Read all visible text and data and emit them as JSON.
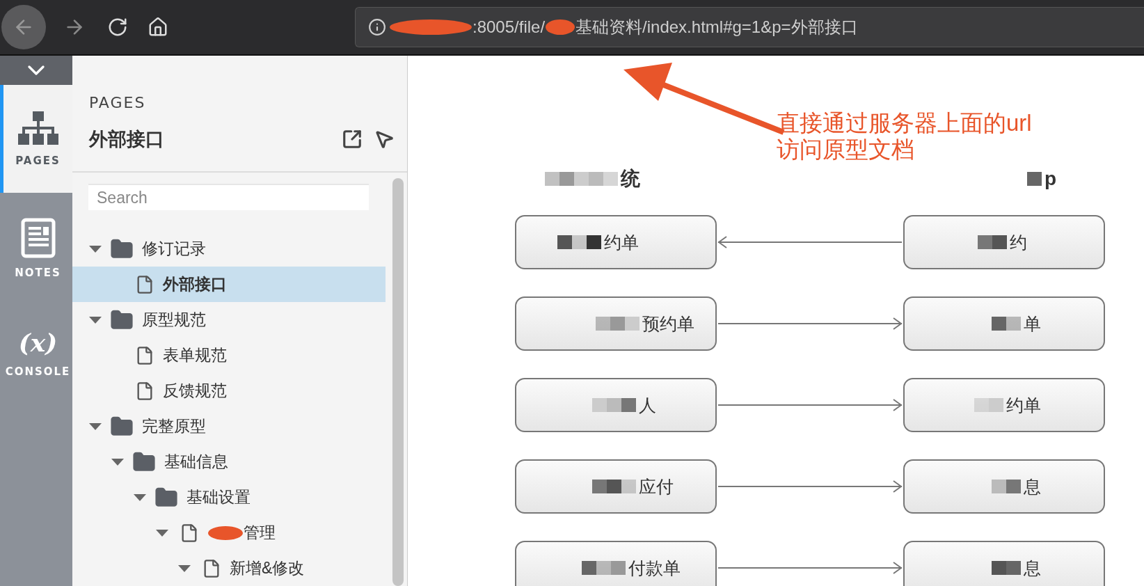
{
  "browser": {
    "address_bar": {
      "segments": [
        {
          "kind": "redacted"
        },
        {
          "kind": "text",
          "text": ":8005/file/"
        },
        {
          "kind": "redacted"
        },
        {
          "kind": "text",
          "text": "基础资料/index.html#g=1&p=外部接口"
        }
      ]
    }
  },
  "rail": {
    "tabs": [
      {
        "label": "PAGES",
        "selected": true
      },
      {
        "label": "NOTES",
        "selected": false
      },
      {
        "label": "CONSOLE",
        "icon_text": "(x)",
        "selected": false
      }
    ]
  },
  "pages_panel": {
    "heading": "PAGES",
    "title": "外部接口",
    "search": {
      "placeholder": "Search"
    },
    "tree": [
      {
        "label": "修订记录",
        "kind": "folder",
        "expanded": true,
        "selected": false,
        "children": [
          {
            "label": "外部接口",
            "kind": "page",
            "selected": true
          }
        ]
      },
      {
        "label": "原型规范",
        "kind": "folder",
        "expanded": true,
        "selected": false,
        "children": [
          {
            "label": "表单规范",
            "kind": "page",
            "selected": false
          },
          {
            "label": "反馈规范",
            "kind": "page",
            "selected": false
          }
        ]
      },
      {
        "label": "完整原型",
        "kind": "folder",
        "expanded": true,
        "selected": false,
        "children": [
          {
            "label": "基础信息",
            "kind": "folder",
            "expanded": true,
            "selected": false,
            "children": [
              {
                "label": "基础设置",
                "kind": "folder",
                "expanded": true,
                "selected": false,
                "children": [
                  {
                    "label": "管理",
                    "redacted": true,
                    "kind": "page",
                    "expanded": true,
                    "selected": false,
                    "children": [
                      {
                        "label": "新增&修改",
                        "kind": "page",
                        "expanded": true,
                        "selected": false
                      }
                    ]
                  }
                ]
              }
            ]
          }
        ]
      }
    ]
  },
  "annotation": {
    "text": "直接通过服务器上面的url\n访问原型文档"
  },
  "diagram": {
    "left_header": {
      "text": "统",
      "mosaic": true
    },
    "right_header": {
      "text": "p",
      "mosaic": true
    },
    "rows": [
      {
        "left": {
          "text": "约单",
          "mosaic": true
        },
        "reversed": true,
        "right": {
          "text": "约",
          "mosaic": true
        }
      },
      {
        "left": {
          "text": "预约单",
          "mosaic": true
        },
        "reversed": false,
        "right": {
          "text": "单",
          "mosaic": true
        }
      },
      {
        "left": {
          "text": "人",
          "mosaic": true
        },
        "reversed": false,
        "right": {
          "text": "约单",
          "mosaic": true
        }
      },
      {
        "left": {
          "text": "应付",
          "mosaic": true
        },
        "reversed": false,
        "right": {
          "text": "息",
          "mosaic": true
        }
      },
      {
        "left": {
          "text": "付款单",
          "mosaic": true
        },
        "reversed": false,
        "right": {
          "text": "息",
          "mosaic": true
        }
      }
    ]
  }
}
